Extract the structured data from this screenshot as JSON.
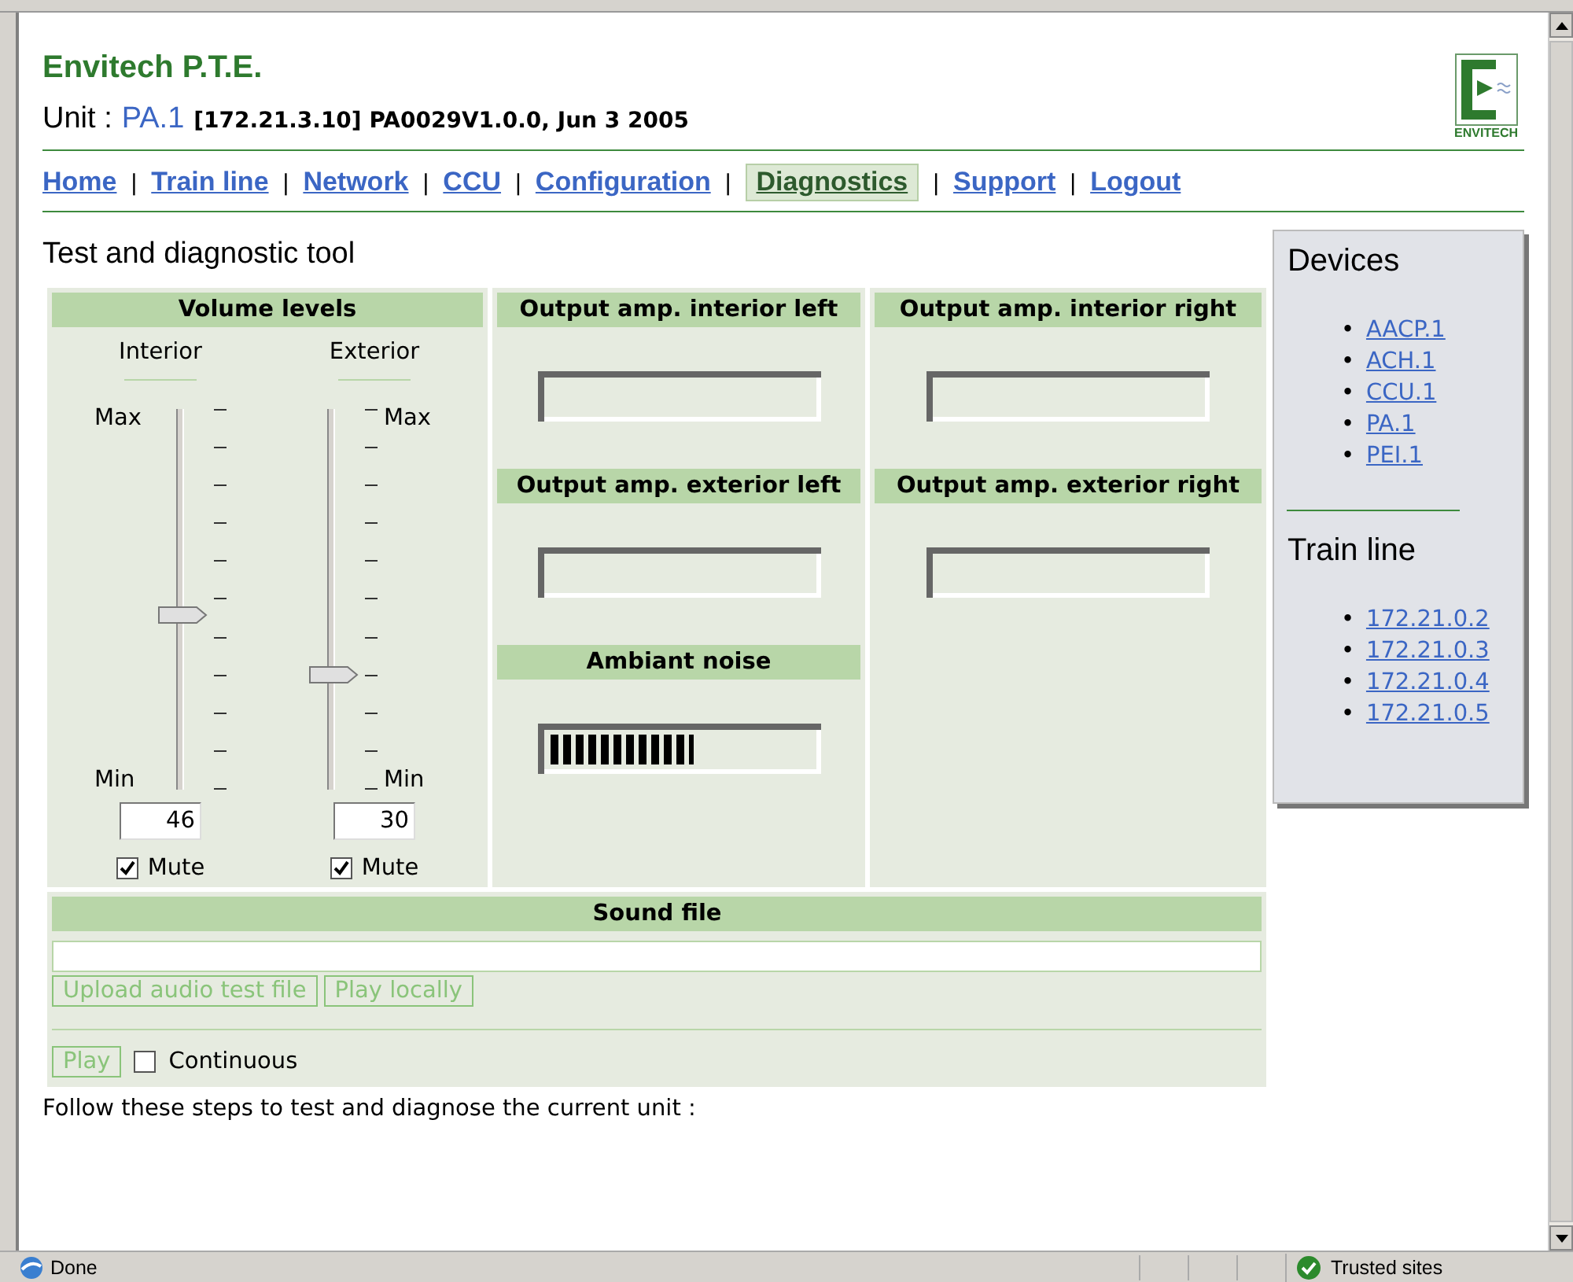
{
  "header": {
    "title": "Envitech P.T.E.",
    "unit_label": "Unit :",
    "unit_name": "PA.1",
    "unit_info": "[172.21.3.10] PA0029V1.0.0, Jun 3 2005",
    "logo_text": "ENVITECH"
  },
  "nav": [
    {
      "kind": "link",
      "label": "Home",
      "selected": false
    },
    {
      "kind": "separator",
      "text": "|"
    },
    {
      "kind": "link",
      "label": "Train line",
      "selected": false
    },
    {
      "kind": "separator",
      "text": "|"
    },
    {
      "kind": "link",
      "label": "Network",
      "selected": false
    },
    {
      "kind": "separator",
      "text": "|"
    },
    {
      "kind": "link",
      "label": "CCU",
      "selected": false
    },
    {
      "kind": "separator",
      "text": "|"
    },
    {
      "kind": "link",
      "label": "Configuration",
      "selected": false
    },
    {
      "kind": "separator",
      "text": "|"
    },
    {
      "kind": "link",
      "label": "Diagnostics",
      "selected": true
    },
    {
      "kind": "separator",
      "text": "|"
    },
    {
      "kind": "link",
      "label": "Support",
      "selected": false
    },
    {
      "kind": "separator",
      "text": "|"
    },
    {
      "kind": "link",
      "label": "Logout",
      "selected": false
    }
  ],
  "page_title": "Test and diagnostic tool",
  "volume": {
    "heading": "Volume levels",
    "sliders": [
      {
        "label": "Interior",
        "kind": "left",
        "max_label": "Max",
        "min_label": "Min",
        "level": 0.46,
        "value": "46",
        "muted": true,
        "mute_label": "Mute"
      },
      {
        "label": "Exterior",
        "kind": "right",
        "max_label": "Max",
        "min_label": "Min",
        "level": 0.3,
        "value": "30",
        "muted": true,
        "mute_label": "Mute"
      }
    ]
  },
  "meter_columns": [
    [
      {
        "heading": "Output amp. interior left",
        "kind": "amp"
      },
      {
        "heading": "Output amp. exterior left",
        "kind": "amp"
      },
      {
        "heading": "Ambiant noise",
        "kind": "noise",
        "level": 0.55
      }
    ],
    [
      {
        "heading": "Output amp. interior right",
        "kind": "amp"
      },
      {
        "heading": "Output amp. exterior right",
        "kind": "amp"
      }
    ]
  ],
  "sound_file": {
    "heading": "Sound file",
    "upload_button": "Upload audio test file",
    "play_locally_button": "Play locally",
    "play_button": "Play",
    "continuous_label": "Continuous",
    "continuous": false
  },
  "instructions": "Follow these steps to test and diagnose the current unit :",
  "sidebar": {
    "sections": [
      {
        "title": "Devices",
        "links": [
          {
            "bullet": "•",
            "label": "AACP.1"
          },
          {
            "bullet": "•",
            "label": "ACH.1"
          },
          {
            "bullet": "•",
            "label": "CCU.1"
          },
          {
            "bullet": "•",
            "label": "PA.1"
          },
          {
            "bullet": "•",
            "label": "PEI.1"
          }
        ]
      },
      {
        "title": "Train line",
        "links": [
          {
            "bullet": "•",
            "label": "172.21.0.2"
          },
          {
            "bullet": "•",
            "label": "172.21.0.3"
          },
          {
            "bullet": "•",
            "label": "172.21.0.4"
          },
          {
            "bullet": "•",
            "label": "172.21.0.5"
          }
        ]
      }
    ]
  },
  "status_bar": {
    "status": "Done",
    "zone": "Trusted sites"
  }
}
